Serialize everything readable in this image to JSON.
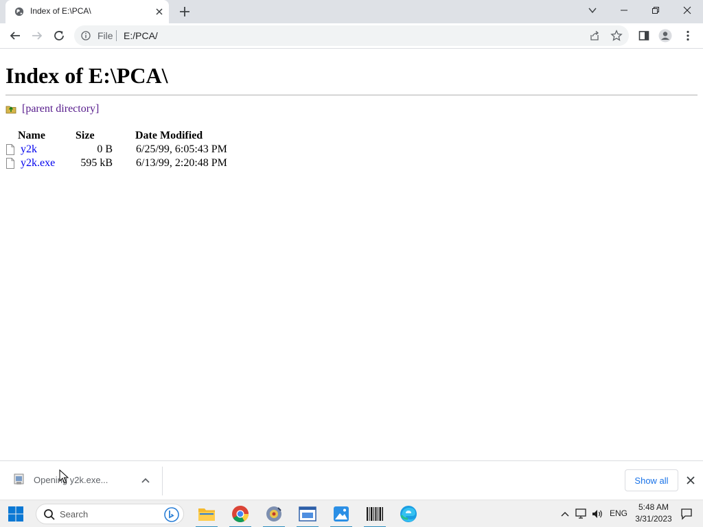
{
  "browser": {
    "tab": {
      "title": "Index of E:\\PCA\\"
    },
    "omnibox": {
      "scheme_label": "File",
      "url": "E:/PCA/"
    }
  },
  "page": {
    "heading": "Index of E:\\PCA\\",
    "parent_link": "[parent directory]",
    "columns": {
      "name": "Name",
      "size": "Size",
      "date": "Date Modified"
    },
    "files": [
      {
        "name": "y2k",
        "size": "0 B",
        "date": "6/25/99, 6:05:43 PM"
      },
      {
        "name": "y2k.exe",
        "size": "595 kB",
        "date": "6/13/99, 2:20:48 PM"
      }
    ]
  },
  "downloads": {
    "item_text": "Opening y2k.exe...",
    "show_all": "Show all"
  },
  "taskbar": {
    "search_placeholder": "Search",
    "language": "ENG",
    "time": "5:48 AM",
    "date": "3/31/2023",
    "accent_color": "#2a8cbd"
  }
}
